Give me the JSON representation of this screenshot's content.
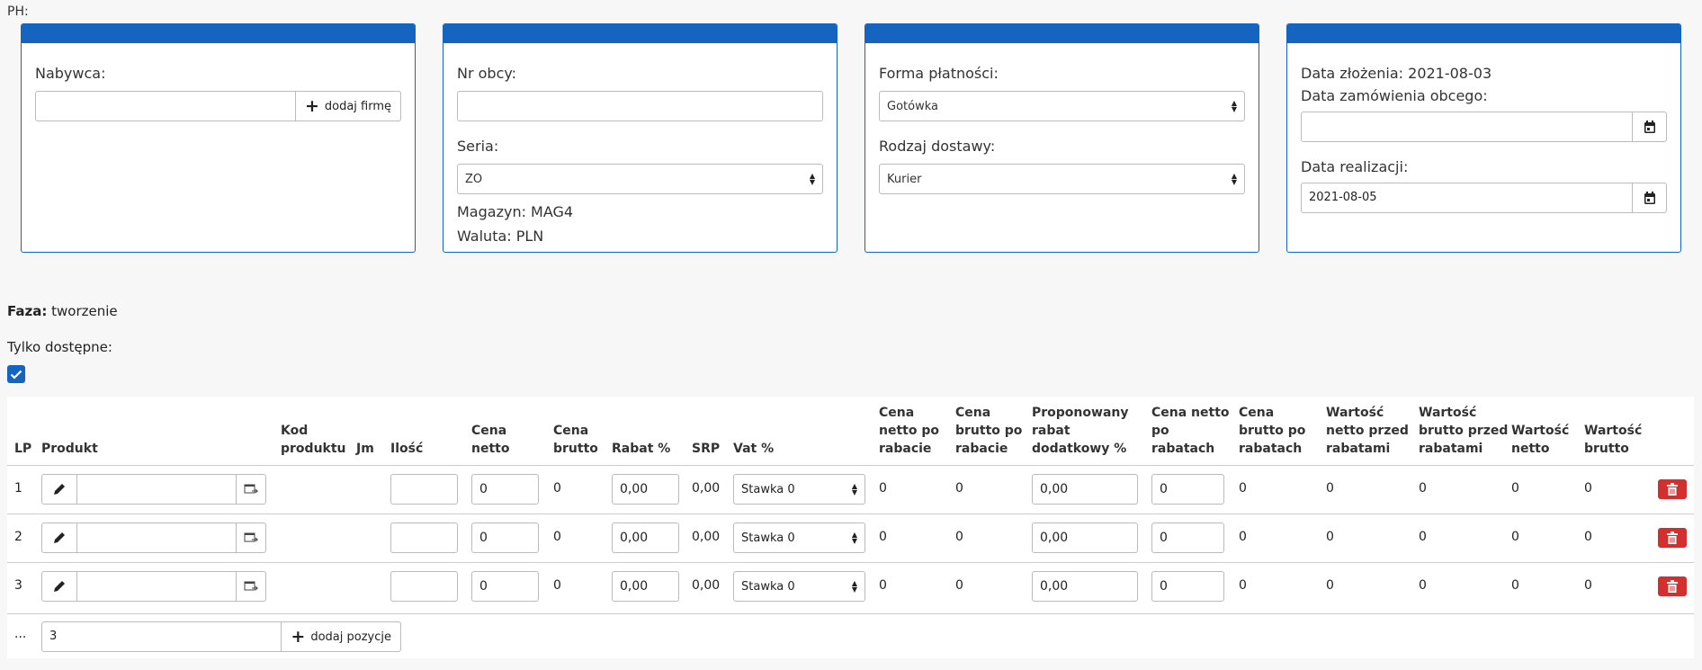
{
  "top_label": "PH:",
  "cards": {
    "buyer": {
      "label": "Nabywca:",
      "input_value": "",
      "add_company_label": "dodaj firmę"
    },
    "doc": {
      "nr_obcy_label": "Nr obcy:",
      "nr_obcy_value": "",
      "seria_label": "Seria:",
      "seria_value": "ZO",
      "magazyn": "Magazyn: MAG4",
      "waluta": "Waluta: PLN"
    },
    "payment": {
      "forma_label": "Forma płatności:",
      "forma_value": "Gotówka",
      "dostawa_label": "Rodzaj dostawy:",
      "dostawa_value": "Kurier"
    },
    "dates": {
      "data_zlozenia": "Data złożenia: 2021-08-03",
      "data_zam_label": "Data zamówienia obcego:",
      "data_zam_value": "",
      "data_real_label": "Data realizacji:",
      "data_real_value": "2021-08-05"
    }
  },
  "faza_label": "Faza:",
  "faza_value": "tworzenie",
  "tylko_label": "Tylko dostępne:",
  "tylko_checked": true,
  "columns": [
    "LP",
    "Produkt",
    "Kod produktu",
    "Jm",
    "Ilość",
    "Cena netto",
    "Cena brutto",
    "Rabat %",
    "SRP",
    "Vat %",
    "Cena netto po rabacie",
    "Cena brutto po rabacie",
    "Proponowany rabat dodatkowy %",
    "Cena netto po rabatach",
    "Cena brutto po rabatach",
    "Wartość netto przed rabatami",
    "Wartość brutto przed rabatami",
    "Wartość netto",
    "Wartość brutto"
  ],
  "rows": [
    {
      "lp": "1",
      "ilosc": "",
      "cena_netto": "0",
      "cena_brutto": "0",
      "rabat": "0,00",
      "srp": "0,00",
      "vat": "Stawka 0",
      "netto_po_rabacie": "0",
      "brutto_po_rabacie": "0",
      "proponowany": "0,00",
      "netto_po_rabatach": "0",
      "brutto_po_rabatach": "0",
      "wart_netto_przed": "0",
      "wart_brutto_przed": "0",
      "wart_netto": "0",
      "wart_brutto": "0"
    },
    {
      "lp": "2",
      "ilosc": "",
      "cena_netto": "0",
      "cena_brutto": "0",
      "rabat": "0,00",
      "srp": "0,00",
      "vat": "Stawka 0",
      "netto_po_rabacie": "0",
      "brutto_po_rabacie": "0",
      "proponowany": "0,00",
      "netto_po_rabatach": "0",
      "brutto_po_rabatach": "0",
      "wart_netto_przed": "0",
      "wart_brutto_przed": "0",
      "wart_netto": "0",
      "wart_brutto": "0"
    },
    {
      "lp": "3",
      "ilosc": "",
      "cena_netto": "0",
      "cena_brutto": "0",
      "rabat": "0,00",
      "srp": "0,00",
      "vat": "Stawka 0",
      "netto_po_rabacie": "0",
      "brutto_po_rabacie": "0",
      "proponowany": "0,00",
      "netto_po_rabatach": "0",
      "brutto_po_rabatach": "0",
      "wart_netto_przed": "0",
      "wart_brutto_przed": "0",
      "wart_netto": "0",
      "wart_brutto": "0"
    }
  ],
  "footer": {
    "ellipsis": "...",
    "count_value": "3",
    "add_position_label": "dodaj pozycje"
  },
  "colors": {
    "primary": "#1565c0",
    "danger": "#d32f2f"
  }
}
